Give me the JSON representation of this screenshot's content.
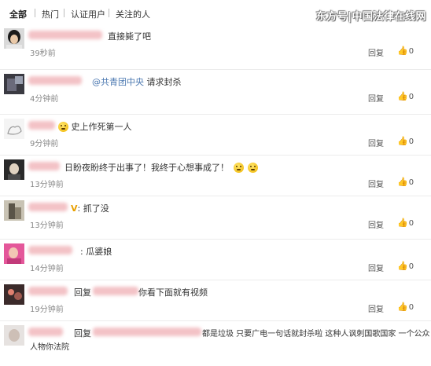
{
  "tabs": [
    "全部",
    "热门",
    "认证用户",
    "关注的人"
  ],
  "watermark": "东方号|中国法律在线网",
  "comments": [
    {
      "text": "直接毙了吧",
      "time": "39秒前",
      "reply": "回复",
      "likes": "0"
    },
    {
      "mention": "@共青团中央",
      "text": "请求封杀",
      "time": "4分钟前",
      "reply": "回复",
      "likes": "0"
    },
    {
      "text": "史上作死第一人",
      "time": "9分钟前",
      "reply": "回复",
      "likes": "0"
    },
    {
      "text": "日盼夜盼终于出事了！我终于心想事成了！",
      "time": "13分钟前",
      "reply": "回复",
      "likes": "0"
    },
    {
      "badge": "V",
      "text": "抓了没",
      "time": "13分钟前",
      "reply": "回复",
      "likes": "0"
    },
    {
      "text": "瓜婆娘",
      "time": "14分钟前",
      "reply": "回复",
      "likes": "0"
    },
    {
      "reply_prefix": "回复",
      "text": "你看下面就有视频",
      "time": "19分钟前",
      "reply": "回复",
      "likes": "0"
    },
    {
      "reply_prefix": "回复",
      "text": "都是垃圾 只要广电一句话就封杀啦 这种人讽刺国歌国家 一个公众",
      "text2": "人物你法院"
    }
  ],
  "colors": {
    "mention": "#4a77b0",
    "time": "#888888",
    "divider": "#ececec"
  },
  "icons": {
    "like": "thumbs-up-icon",
    "emoji": "smiley-emoji-icon"
  }
}
